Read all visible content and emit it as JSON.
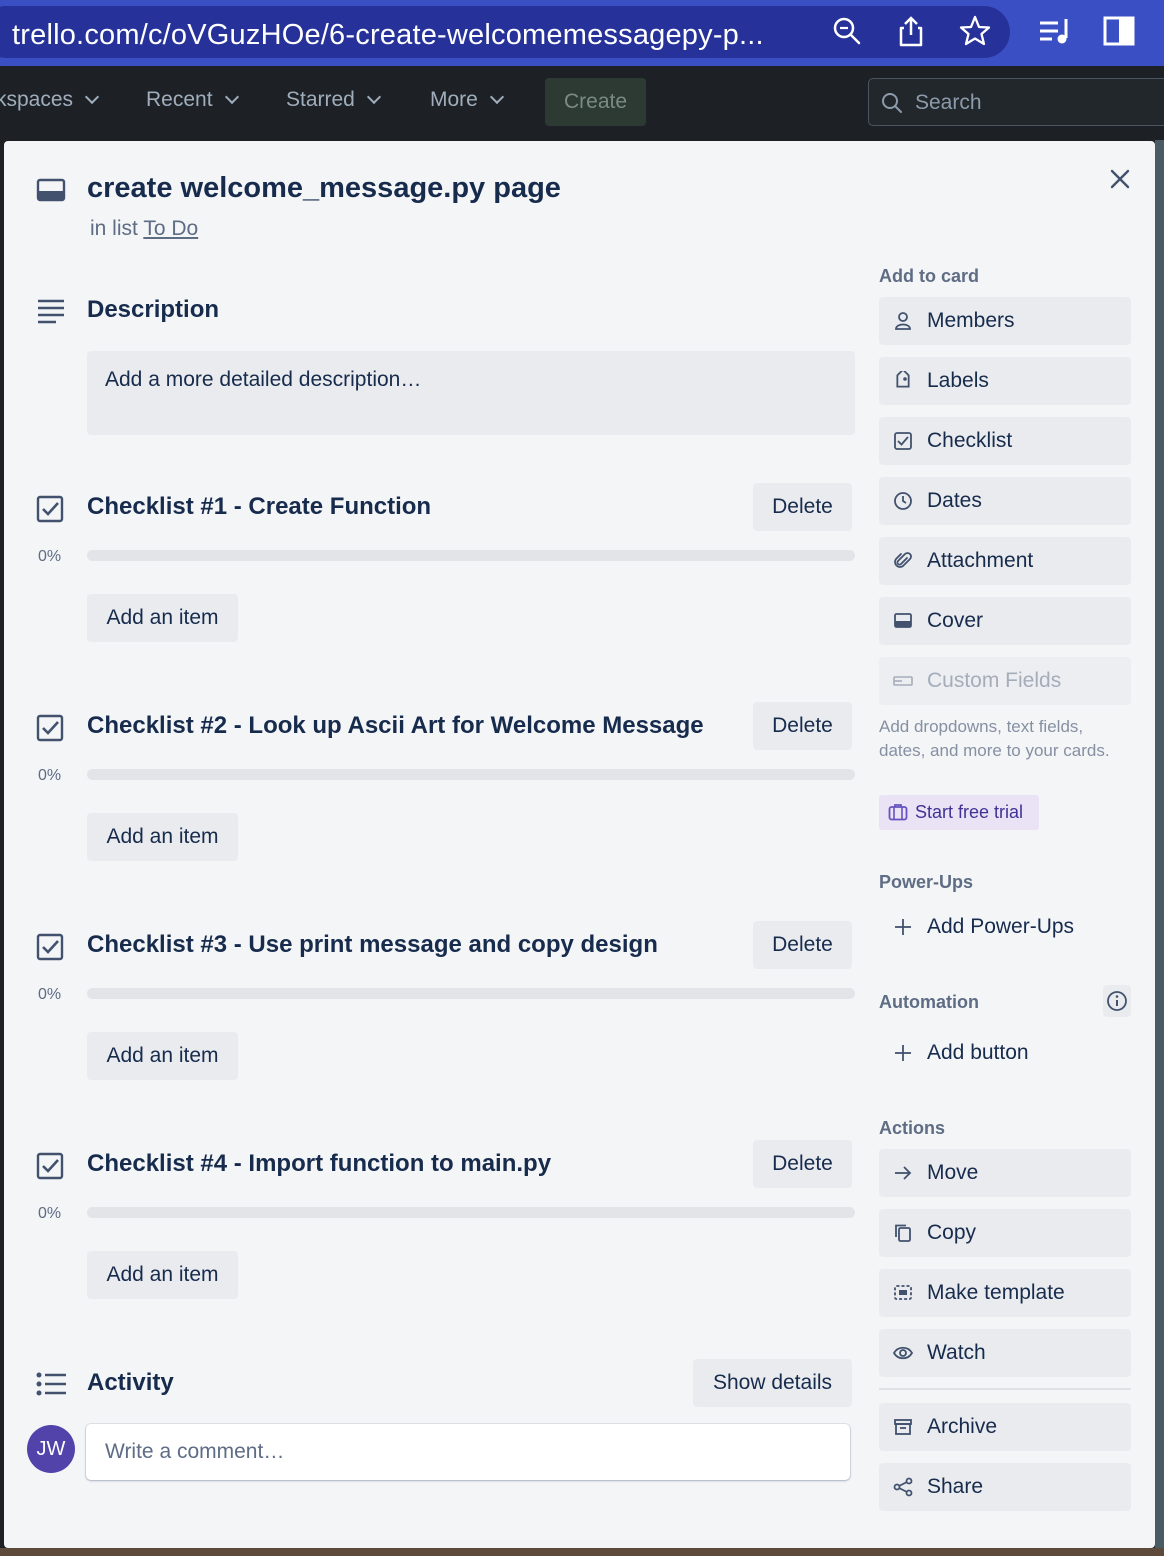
{
  "browser": {
    "url": "trello.com/c/oVGuzHOe/6-create-welcomemessagepy-p..."
  },
  "nav": {
    "workspaces": "kspaces",
    "recent": "Recent",
    "starred": "Starred",
    "more": "More",
    "create": "Create",
    "search_placeholder": "Search"
  },
  "card": {
    "title": "create welcome_message.py page",
    "in_list_prefix": "in list",
    "list_name": "To Do",
    "description_title": "Description",
    "description_placeholder": "Add a more detailed description…",
    "checklists": [
      {
        "title": "Checklist #1 - Create Function",
        "percent": "0%",
        "progress": 0,
        "delete_label": "Delete",
        "add_item_label": "Add an item"
      },
      {
        "title": "Checklist #2 - Look up Ascii Art for Welcome Message",
        "percent": "0%",
        "progress": 0,
        "delete_label": "Delete",
        "add_item_label": "Add an item"
      },
      {
        "title": "Checklist #3 - Use print message and copy design",
        "percent": "0%",
        "progress": 0,
        "delete_label": "Delete",
        "add_item_label": "Add an item"
      },
      {
        "title": "Checklist #4 - Import function to main.py",
        "percent": "0%",
        "progress": 0,
        "delete_label": "Delete",
        "add_item_label": "Add an item"
      }
    ],
    "activity_title": "Activity",
    "show_details": "Show details",
    "avatar_initials": "JW",
    "comment_placeholder": "Write a comment…"
  },
  "sidebar": {
    "add_to_card_label": "Add to card",
    "add_to_card": [
      {
        "label": "Members",
        "icon": "person-icon"
      },
      {
        "label": "Labels",
        "icon": "tag-icon"
      },
      {
        "label": "Checklist",
        "icon": "checkbox-icon"
      },
      {
        "label": "Dates",
        "icon": "clock-icon"
      },
      {
        "label": "Attachment",
        "icon": "paperclip-icon"
      },
      {
        "label": "Cover",
        "icon": "cover-icon"
      },
      {
        "label": "Custom Fields",
        "icon": "custom-fields-icon",
        "disabled": true
      }
    ],
    "custom_fields_promo": "Add dropdowns, text fields, dates, and more to your cards.",
    "start_trial": "Start free trial",
    "powerups_label": "Power-Ups",
    "add_powerups": "Add Power-Ups",
    "automation_label": "Automation",
    "add_button": "Add button",
    "actions_label": "Actions",
    "actions": [
      {
        "label": "Move",
        "icon": "arrow-right-icon"
      },
      {
        "label": "Copy",
        "icon": "copy-icon"
      },
      {
        "label": "Make template",
        "icon": "template-icon"
      },
      {
        "label": "Watch",
        "icon": "eye-icon"
      },
      {
        "label": "Archive",
        "icon": "archive-icon"
      },
      {
        "label": "Share",
        "icon": "share-icon"
      }
    ]
  },
  "colors": {
    "browser_bar": "#3a4fc4",
    "app_header": "#1d2125",
    "modal_bg": "#f4f5f7",
    "button_bg": "#e9ebee",
    "text_primary": "#172b4d",
    "text_secondary": "#5e6c84",
    "avatar": "#5243aa",
    "trial_bg": "#eae3f5"
  }
}
